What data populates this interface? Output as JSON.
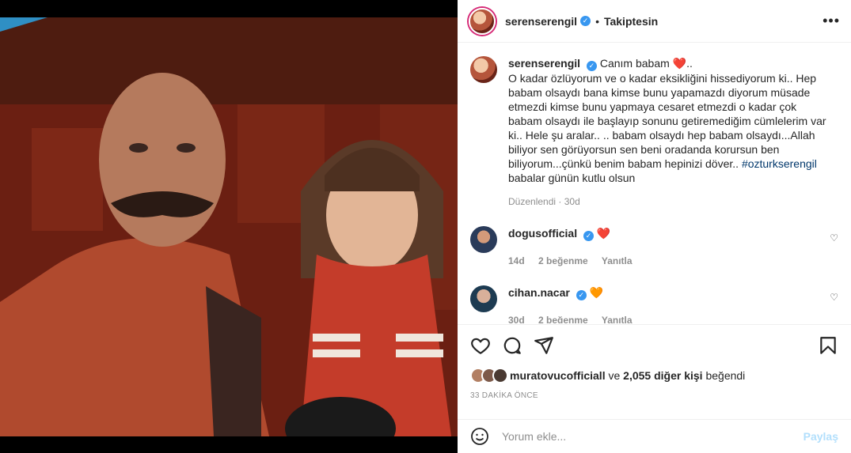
{
  "post": {
    "username": "serenserengil",
    "follow_status": "Takiptesin",
    "more_icon": "ellipsis-icon"
  },
  "caption": {
    "username": "serenserengil",
    "text": "Canım babam ❤️..\nO kadar özlüyorum ve o kadar eksikliğini hissediyorum ki.. Hep babam olsaydı bana kimse bunu yapamazdı diyorum müsade etmezdi kimse bunu yapmaya cesaret etmezdi o kadar çok babam olsaydı ile başlayıp sonunu getiremediğim cümlelerim var ki.. Hele şu aralar.. .. babam olsaydı hep babam olsaydı...Allah biliyor sen görüyorsun sen beni oradanda korursun ben biliyorum...çünkü benim babam hepinizi döver..",
    "hashtag": "#ozturkserengil",
    "tail": " babalar günün kutlu olsun",
    "edited": "Düzenlendi",
    "age": "30d"
  },
  "comments": [
    {
      "username": "dogusofficial",
      "text": "❤️",
      "age": "14d",
      "likes": "2 beğenme",
      "reply": "Yanıtla"
    },
    {
      "username": "cihan.nacar",
      "text": "🧡",
      "age": "30d",
      "likes": "2 beğenme",
      "reply": "Yanıtla"
    }
  ],
  "likes": {
    "first_user": "muratovucofficiall",
    "connector": " ve ",
    "others": "2,055 diğer kişi",
    "suffix": " beğendi"
  },
  "timestamp": "33 DAKİKA ÖNCE",
  "comment_input": {
    "placeholder": "Yorum ekle...",
    "share_label": "Paylaş"
  }
}
